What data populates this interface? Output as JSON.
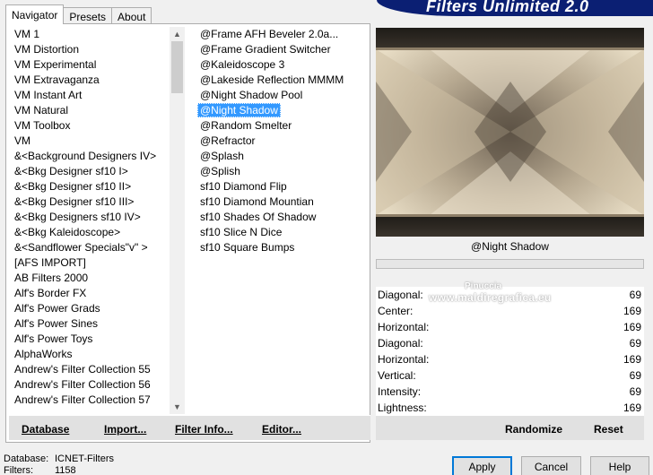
{
  "banner": {
    "title": "Filters Unlimited 2.0"
  },
  "tabs": [
    {
      "label": "Navigator"
    },
    {
      "label": "Presets"
    },
    {
      "label": "About"
    }
  ],
  "categories": [
    "VM 1",
    "VM Distortion",
    "VM Experimental",
    "VM Extravaganza",
    "VM Instant Art",
    "VM Natural",
    "VM Toolbox",
    "VM",
    "&<Background Designers IV>",
    "&<Bkg Designer sf10 I>",
    "&<Bkg Designer sf10 II>",
    "&<Bkg Designer sf10 III>",
    "&<Bkg Designers sf10 IV>",
    "&<Bkg Kaleidoscope>",
    "&<Sandflower Specials\"v\" >",
    "[AFS IMPORT]",
    "AB Filters 2000",
    "Alf's Border FX",
    "Alf's Power Grads",
    "Alf's Power Sines",
    "Alf's Power Toys",
    "AlphaWorks",
    "Andrew's Filter Collection 55",
    "Andrew's Filter Collection 56",
    "Andrew's Filter Collection 57"
  ],
  "filters": [
    "@Frame AFH Beveler 2.0a...",
    "@Frame Gradient Switcher",
    "@Kaleidoscope 3",
    "@Lakeside Reflection MMMM",
    "@Night Shadow Pool",
    "@Night Shadow",
    "@Random Smelter",
    "@Refractor",
    "@Splash",
    "@Splish",
    "sf10 Diamond Flip",
    "sf10 Diamond Mountian",
    "sf10 Shades Of Shadow",
    "sf10 Slice N Dice",
    "sf10 Square Bumps"
  ],
  "selected_filter_index": 5,
  "selected_filter_name": "@Night Shadow",
  "buttons": {
    "database": "Database",
    "import": "Import...",
    "filter_info": "Filter Info...",
    "editor": "Editor...",
    "randomize": "Randomize",
    "reset": "Reset",
    "apply": "Apply",
    "cancel": "Cancel",
    "help": "Help"
  },
  "params": [
    {
      "label": "Diagonal:",
      "value": "69"
    },
    {
      "label": "Center:",
      "value": "169"
    },
    {
      "label": "Horizontal:",
      "value": "169"
    },
    {
      "label": "Diagonal:",
      "value": "69"
    },
    {
      "label": "Horizontal:",
      "value": "169"
    },
    {
      "label": "Vertical:",
      "value": "69"
    },
    {
      "label": "Intensity:",
      "value": "69"
    },
    {
      "label": "Lightness:",
      "value": "169"
    }
  ],
  "watermark": {
    "line1": "Pinuccia",
    "line2": "www.maldiregrafica.eu"
  },
  "status": {
    "database_key": "Database:",
    "database_value": "ICNET-Filters",
    "filters_key": "Filters:",
    "filters_value": "1158"
  },
  "colors": {
    "banner": "#0b1f73",
    "selection": "#3399ff",
    "preview_light": "#e9dcc2",
    "preview_dark": "#2a2520"
  }
}
